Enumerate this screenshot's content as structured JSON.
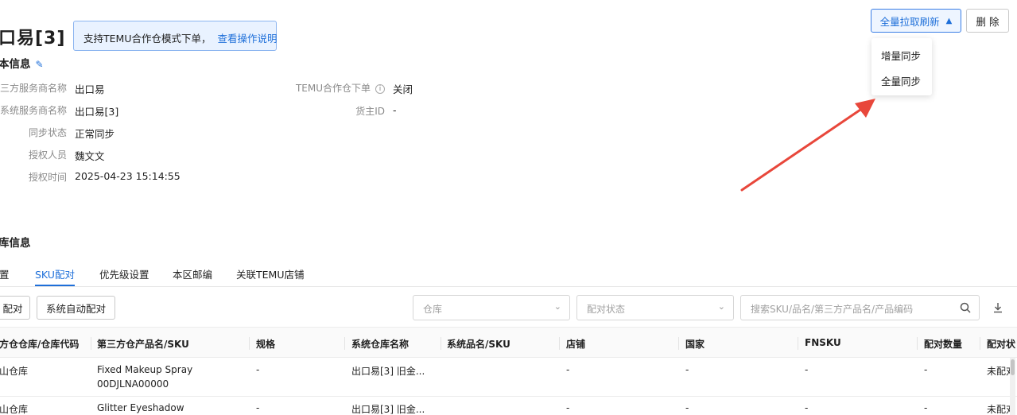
{
  "page": {
    "title": "口易[3]",
    "notice": {
      "text": "支持TEMU合作仓模式下单，",
      "link": "查看操作说明"
    }
  },
  "header_actions": {
    "refresh_label": "全量拉取刷新",
    "refresh_dropdown": [
      "增量同步",
      "全量同步"
    ],
    "delete_label": "删 除"
  },
  "basic_info": {
    "section_title": "本信息",
    "left_fields": [
      {
        "label": "三方服务商名称",
        "value": "出口易"
      },
      {
        "label": "系统服务商名称",
        "value": "出口易[3]"
      },
      {
        "label": "同步状态",
        "value": "正常同步"
      },
      {
        "label": "授权人员",
        "value": "魏文文"
      },
      {
        "label": "授权时间",
        "value": "2025-04-23 15:14:55"
      }
    ],
    "right_fields": [
      {
        "label": "TEMU合作仓下单",
        "value": "关闭"
      },
      {
        "label": "货主ID",
        "value": "-"
      }
    ]
  },
  "warehouse_info": {
    "section_title": "库信息",
    "tabs": [
      "置",
      "SKU配对",
      "优先级设置",
      "本区邮编",
      "关联TEMU店铺"
    ],
    "active_tab": "SKU配对"
  },
  "toolbar": {
    "manual_pair_label": "配对",
    "auto_pair_label": "系统自动配对",
    "warehouse_placeholder": "仓库",
    "status_placeholder": "配对状态",
    "search_placeholder": "搜索SKU/品名/第三方产品名/产品编码"
  },
  "table": {
    "columns": [
      "方仓仓库/仓库代码",
      "第三方仓产品名/SKU",
      "规格",
      "系统仓库名称",
      "系统品名/SKU",
      "店铺",
      "国家",
      "FNSKU",
      "配对数量",
      "配对状"
    ],
    "rows": [
      {
        "warehouse": "山仓库",
        "product_name": "Fixed Makeup Spray",
        "product_sku": "00DJLNA00000",
        "spec": "-",
        "sys_warehouse": "出口易[3] 旧金...",
        "sys_sku": "",
        "shop": "-",
        "country": "-",
        "fnsku": "-",
        "qty": "-",
        "status": "未配对"
      },
      {
        "warehouse": "山仓库",
        "product_name": "Glitter Eyeshadow",
        "product_sku": "",
        "spec": "-",
        "sys_warehouse": "出口易[3] 旧金...",
        "sys_sku": "",
        "shop": "-",
        "country": "-",
        "fnsku": "-",
        "qty": "-",
        "status": "未配对"
      }
    ]
  },
  "colors": {
    "accent": "#1e6fd9",
    "arrow": "#e8473b",
    "notice_bg": "#e9f2ff"
  }
}
